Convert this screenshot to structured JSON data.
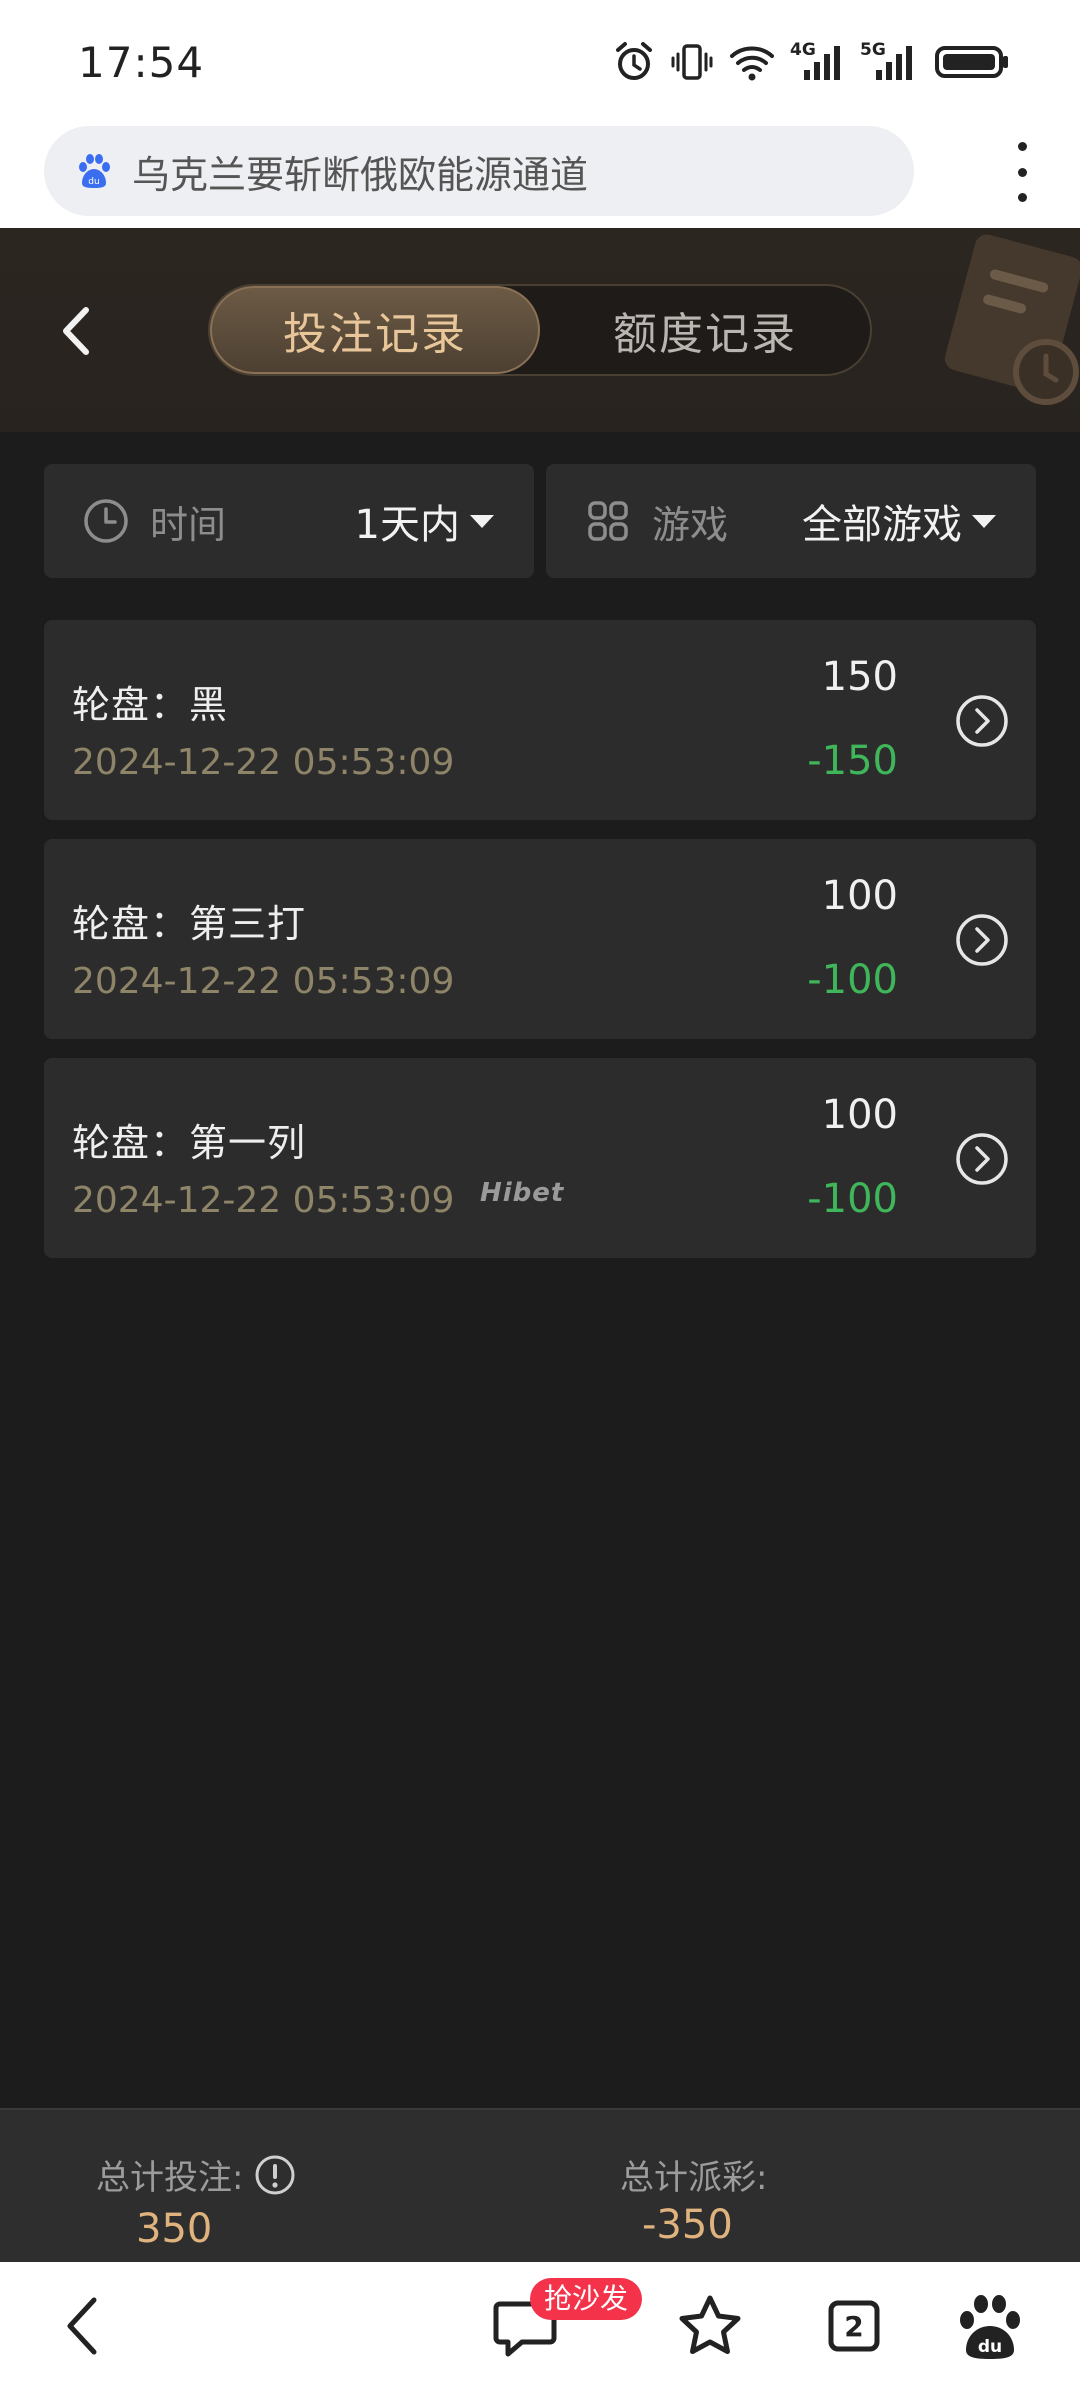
{
  "status_bar": {
    "time": "17:54",
    "network_a": "4G",
    "network_b": "5G"
  },
  "browser": {
    "address_text": "乌克兰要斩断俄欧能源通道"
  },
  "header": {
    "tabs": [
      {
        "label": "投注记录",
        "active": true
      },
      {
        "label": "额度记录",
        "active": false
      }
    ]
  },
  "filters": {
    "time_label": "时间",
    "time_value": "1天内",
    "game_label": "游戏",
    "game_value": "全部游戏"
  },
  "records": [
    {
      "title": "轮盘：黑",
      "time": "2024-12-22 05:53:09",
      "amount": "150",
      "payout": "-150"
    },
    {
      "title": "轮盘：第三打",
      "time": "2024-12-22 05:53:09",
      "amount": "100",
      "payout": "-100"
    },
    {
      "title": "轮盘：第一列",
      "time": "2024-12-22 05:53:09",
      "amount": "100",
      "payout": "-100"
    }
  ],
  "watermark": "Hibet",
  "summary": {
    "total_bet_label": "总计投注:",
    "total_bet_value": "350",
    "total_payout_label": "总计派彩:",
    "total_payout_value": "-350"
  },
  "bottom_nav": {
    "sofa_badge": "抢沙发",
    "tab_count": "2"
  },
  "colors": {
    "accent_gold": "#e8c69a",
    "loss_green": "#3fb65a",
    "panel": "#2c2c2c",
    "background": "#1c1c1c"
  }
}
